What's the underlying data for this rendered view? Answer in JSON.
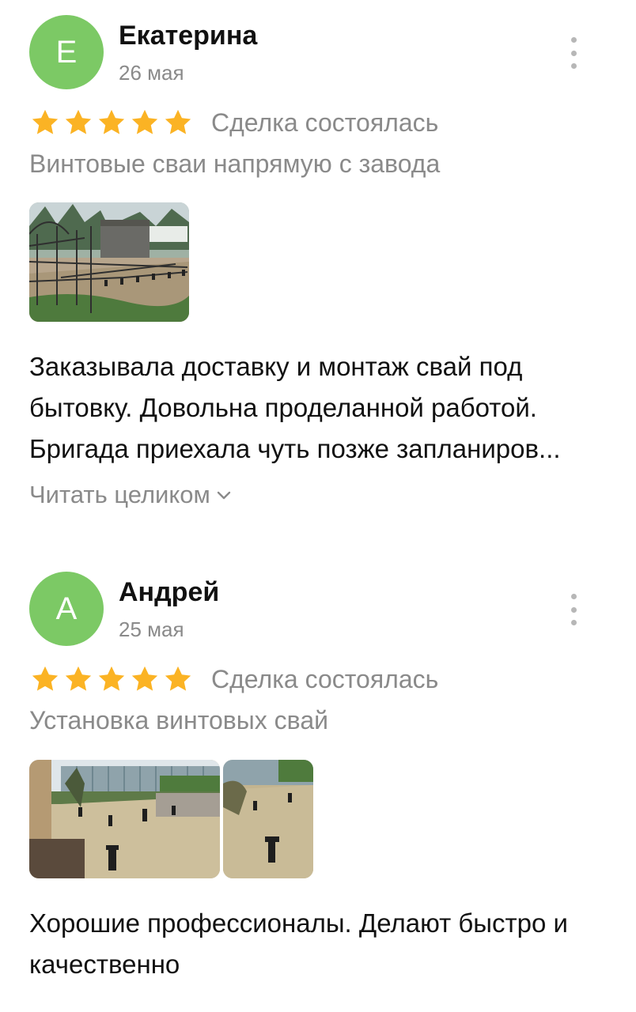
{
  "reviews": [
    {
      "avatar_letter": "Е",
      "name": "Екатерина",
      "date": "26 мая",
      "rating": 5,
      "deal_status": "Сделка состоялась",
      "service": "Винтовые сваи напрямую с завода",
      "text_lines": [
        "Заказывала доставку и монтаж свай под",
        "бытовку. Довольна проделанной работой.",
        "Бригада приехала чуть позже запланиров..."
      ],
      "read_more": "Читать целиком"
    },
    {
      "avatar_letter": "А",
      "name": "Андрей",
      "date": "25 мая",
      "rating": 5,
      "deal_status": "Сделка состоялась",
      "service": "Установка винтовых свай",
      "text_lines": [
        "Хорошие профессионалы. Делают быстро и",
        "качественно"
      ]
    }
  ],
  "colors": {
    "avatar": "#7cc965",
    "star": "#fbb324",
    "muted_text": "#8a8a8a"
  }
}
